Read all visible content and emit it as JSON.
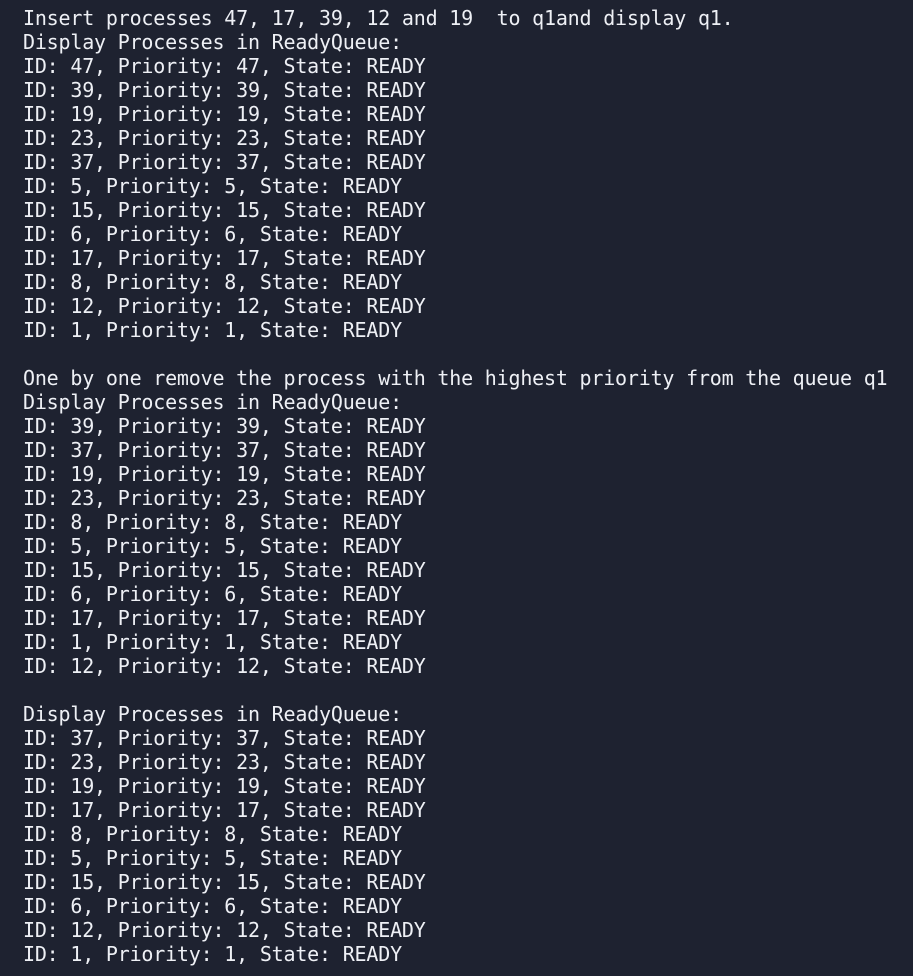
{
  "terminal": {
    "insert_message": "Insert processes 47, 17, 39, 12 and 19  to q1and display q1.",
    "remove_message": "One by one remove the process with the highest priority from the queue q1",
    "display_header": "Display Processes in ReadyQueue:",
    "blocks": [
      {
        "lines": [
          "ID: 47, Priority: 47, State: READY",
          "ID: 39, Priority: 39, State: READY",
          "ID: 19, Priority: 19, State: READY",
          "ID: 23, Priority: 23, State: READY",
          "ID: 37, Priority: 37, State: READY",
          "ID: 5, Priority: 5, State: READY",
          "ID: 15, Priority: 15, State: READY",
          "ID: 6, Priority: 6, State: READY",
          "ID: 17, Priority: 17, State: READY",
          "ID: 8, Priority: 8, State: READY",
          "ID: 12, Priority: 12, State: READY",
          "ID: 1, Priority: 1, State: READY"
        ]
      },
      {
        "lines": [
          "ID: 39, Priority: 39, State: READY",
          "ID: 37, Priority: 37, State: READY",
          "ID: 19, Priority: 19, State: READY",
          "ID: 23, Priority: 23, State: READY",
          "ID: 8, Priority: 8, State: READY",
          "ID: 5, Priority: 5, State: READY",
          "ID: 15, Priority: 15, State: READY",
          "ID: 6, Priority: 6, State: READY",
          "ID: 17, Priority: 17, State: READY",
          "ID: 1, Priority: 1, State: READY",
          "ID: 12, Priority: 12, State: READY"
        ]
      },
      {
        "lines": [
          "ID: 37, Priority: 37, State: READY",
          "ID: 23, Priority: 23, State: READY",
          "ID: 19, Priority: 19, State: READY",
          "ID: 17, Priority: 17, State: READY",
          "ID: 8, Priority: 8, State: READY",
          "ID: 5, Priority: 5, State: READY",
          "ID: 15, Priority: 15, State: READY",
          "ID: 6, Priority: 6, State: READY",
          "ID: 12, Priority: 12, State: READY",
          "ID: 1, Priority: 1, State: READY"
        ]
      }
    ]
  }
}
